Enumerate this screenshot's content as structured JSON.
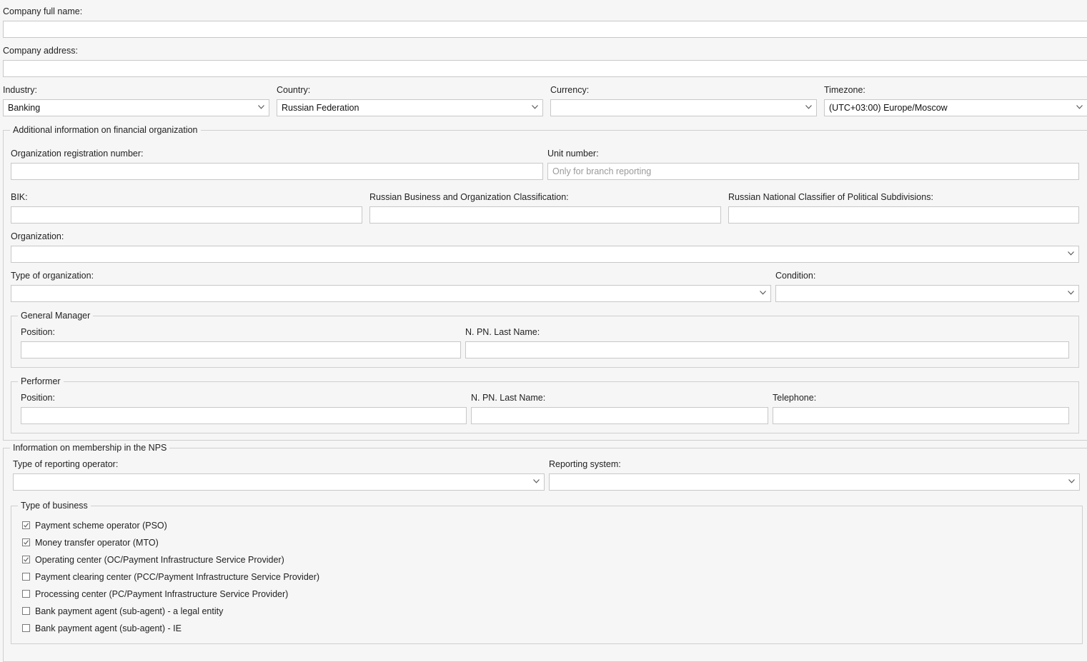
{
  "company": {
    "full_name_label": "Company full name:",
    "full_name_value": "",
    "address_label": "Company address:",
    "address_value": ""
  },
  "selectors": {
    "industry_label": "Industry:",
    "industry_value": "Banking",
    "country_label": "Country:",
    "country_value": "Russian Federation",
    "currency_label": "Currency:",
    "currency_value": "",
    "timezone_label": "Timezone:",
    "timezone_value": "(UTC+03:00) Europe/Moscow"
  },
  "financial": {
    "legend": "Additional information on financial organization",
    "reg_number_label": "Organization registration number:",
    "unit_number_label": "Unit number:",
    "unit_number_placeholder": "Only for branch reporting",
    "bik_label": "BIK:",
    "okpo_label": "Russian Business and Organization Classification:",
    "okato_label": "Russian National Classifier of Political Subdivisions:",
    "organization_label": "Organization:",
    "org_type_label": "Type of organization:",
    "condition_label": "Condition:",
    "general_manager": {
      "legend": "General Manager",
      "position_label": "Position:",
      "name_label": "N. PN. Last Name:"
    },
    "performer": {
      "legend": "Performer",
      "position_label": "Position:",
      "name_label": "N. PN. Last Name:",
      "telephone_label": "Telephone:"
    }
  },
  "nps": {
    "legend": "Information on membership in the NPS",
    "operator_type_label": "Type of reporting operator:",
    "reporting_system_label": "Reporting system:",
    "business": {
      "legend": "Type of business",
      "items": [
        {
          "label": "Payment scheme operator (PSO)",
          "checked": true
        },
        {
          "label": "Money transfer operator (MTO)",
          "checked": true
        },
        {
          "label": "Operating center (OC/Payment Infrastructure Service Provider)",
          "checked": true
        },
        {
          "label": "Payment clearing center (PCC/Payment Infrastructure Service Provider)",
          "checked": false
        },
        {
          "label": "Processing center (PC/Payment Infrastructure Service Provider)",
          "checked": false
        },
        {
          "label": "Bank payment agent (sub-agent) - a legal entity",
          "checked": false
        },
        {
          "label": "Bank payment agent (sub-agent) - IE",
          "checked": false
        }
      ]
    }
  }
}
